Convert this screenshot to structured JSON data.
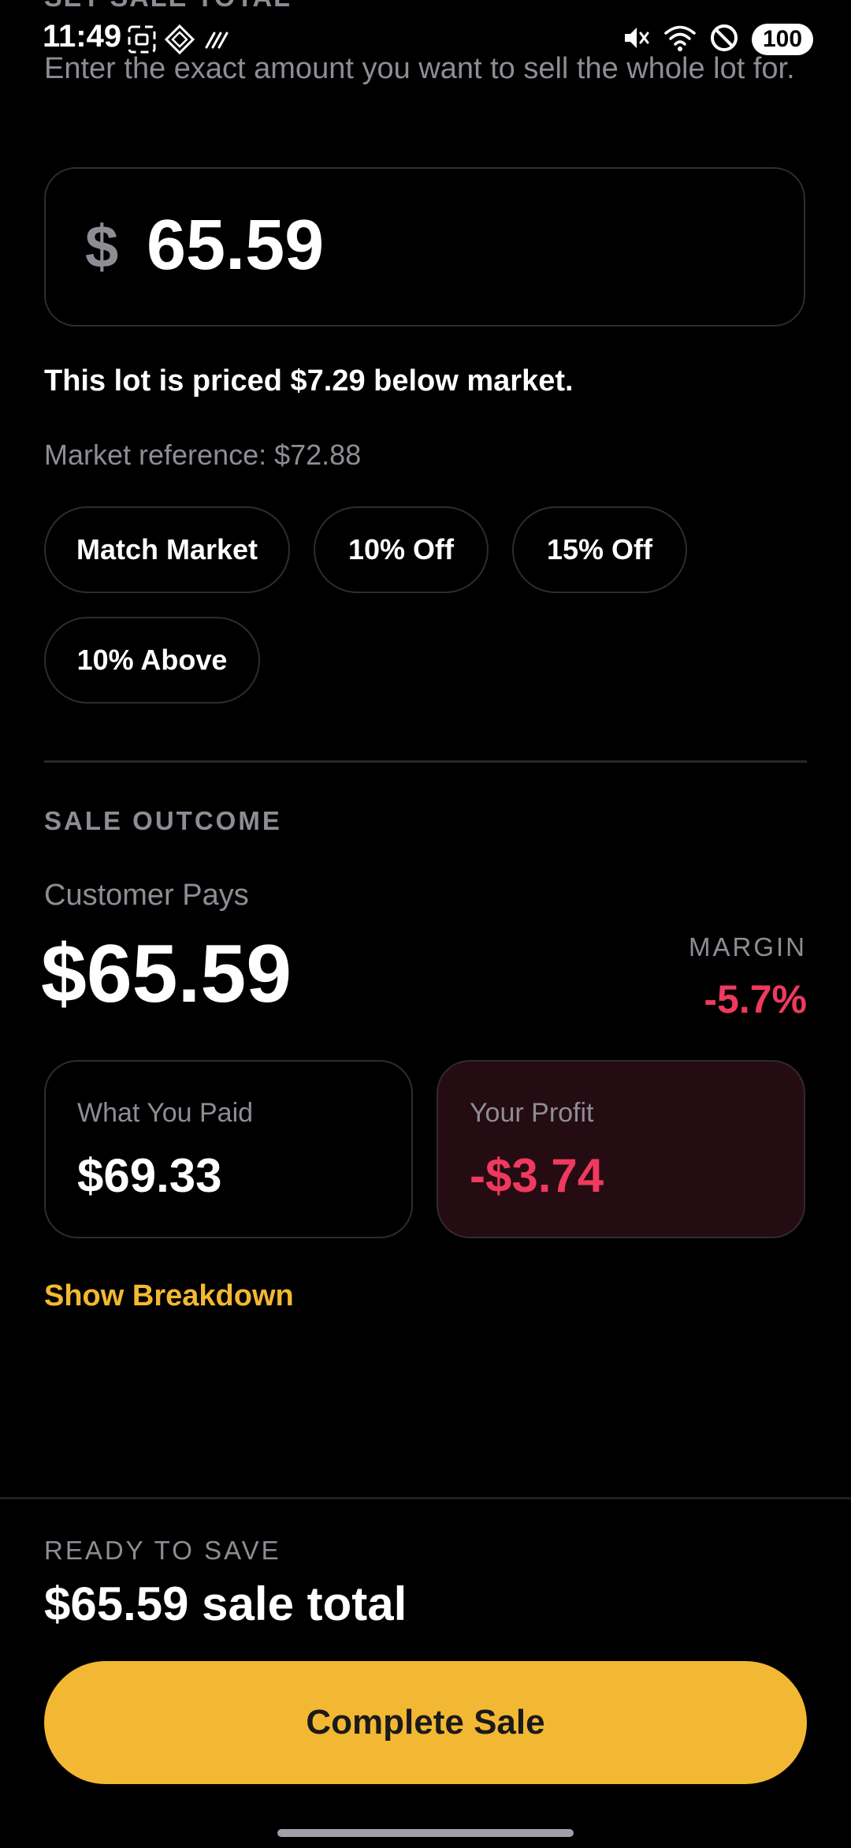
{
  "status_bar": {
    "time": "11:49",
    "battery": "100",
    "left_icons": [
      "screenshot-icon",
      "app-diamond-icon",
      "nfc-icon"
    ],
    "right_icons": [
      "mute-icon",
      "wifi-icon",
      "dnd-icon"
    ]
  },
  "header": {
    "cut_title": "SET SALE TOTAL",
    "instruction": "Enter the exact amount you want to sell the whole lot for."
  },
  "amount_input": {
    "currency_symbol": "$",
    "value": "65.59"
  },
  "pricing": {
    "note": "This lot is priced $7.29 below market.",
    "market_reference": "Market reference: $72.88"
  },
  "presets": [
    {
      "label": "Match Market"
    },
    {
      "label": "10% Off"
    },
    {
      "label": "15% Off"
    },
    {
      "label": "10% Above"
    }
  ],
  "outcome": {
    "section_label": "SALE OUTCOME",
    "customer_pays_label": "Customer Pays",
    "customer_pays_value": "$65.59",
    "margin_label": "MARGIN",
    "margin_value": "-5.7%",
    "paid_label": "What You Paid",
    "paid_value": "$69.33",
    "profit_label": "Your Profit",
    "profit_value": "-$3.74",
    "breakdown_link": "Show Breakdown"
  },
  "footer": {
    "ready_label": "READY TO SAVE",
    "ready_total": "$65.59 sale total",
    "button_label": "Complete Sale"
  },
  "colors": {
    "background": "#000000",
    "accent": "#f3b833",
    "negative": "#f0395e",
    "muted_text": "#8d8d95",
    "border": "#2c2c33",
    "profit_card_bg": "#250b12"
  }
}
